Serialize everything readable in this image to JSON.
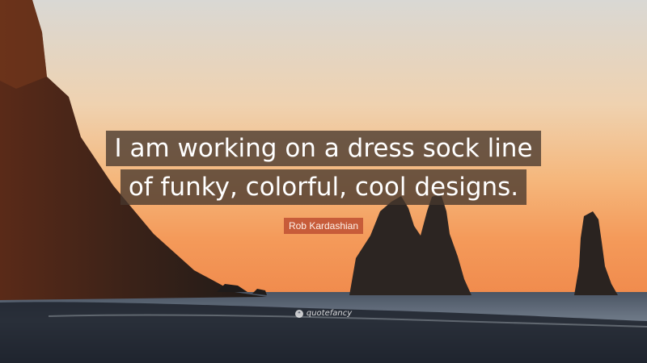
{
  "quote": {
    "lines": [
      "I am working on a dress sock line",
      "of funky, colorful, cool designs."
    ]
  },
  "author": "Rob Kardashian",
  "watermark": {
    "text": "quotefancy",
    "icon": "quotefancy-logo-icon"
  },
  "colors": {
    "sky_top": "#dcd7d0",
    "sky_mid": "#f2c596",
    "sky_horizon": "#f39a57",
    "rock": "#2a2420",
    "sea": "#3b4656",
    "badge": "#be5032"
  }
}
